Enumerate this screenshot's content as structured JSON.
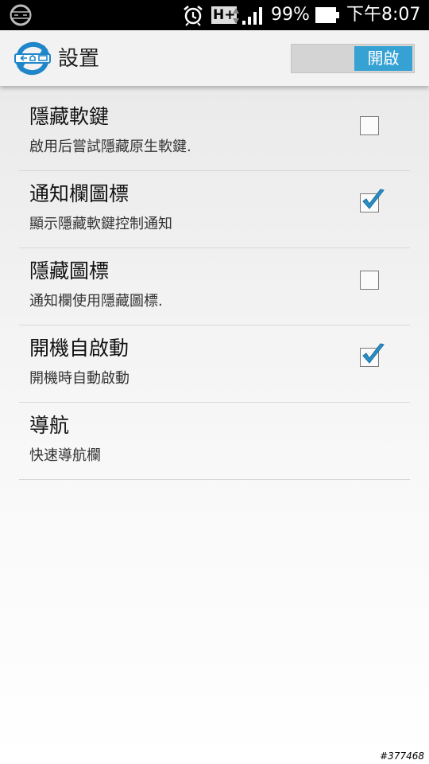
{
  "status_bar": {
    "network": "H+",
    "battery_percent": "99%",
    "time": "下午8:07",
    "icons": [
      "remote-app-icon",
      "alarm-icon",
      "h-plus-network-icon",
      "data-arrows-icon",
      "signal-icon",
      "battery-icon"
    ]
  },
  "action_bar": {
    "title": "設置",
    "toggle_label": "開啟",
    "toggle_state": "on"
  },
  "settings": [
    {
      "title": "隱藏軟鍵",
      "summary": "啟用后嘗試隱藏原生軟鍵.",
      "checkbox": true,
      "checked": false
    },
    {
      "title": "通知欄圖標",
      "summary": "顯示隱藏軟鍵控制通知",
      "checkbox": true,
      "checked": true
    },
    {
      "title": "隱藏圖標",
      "summary": "通知欄使用隱藏圖標.",
      "checkbox": true,
      "checked": false
    },
    {
      "title": "開機自啟動",
      "summary": "開機時自動啟動",
      "checkbox": true,
      "checked": true
    },
    {
      "title": "導航",
      "summary": "快速導航欄",
      "checkbox": false,
      "checked": false
    }
  ],
  "watermark": "#377468",
  "colors": {
    "accent": "#36a1d3",
    "check": "#2a8fc4"
  }
}
